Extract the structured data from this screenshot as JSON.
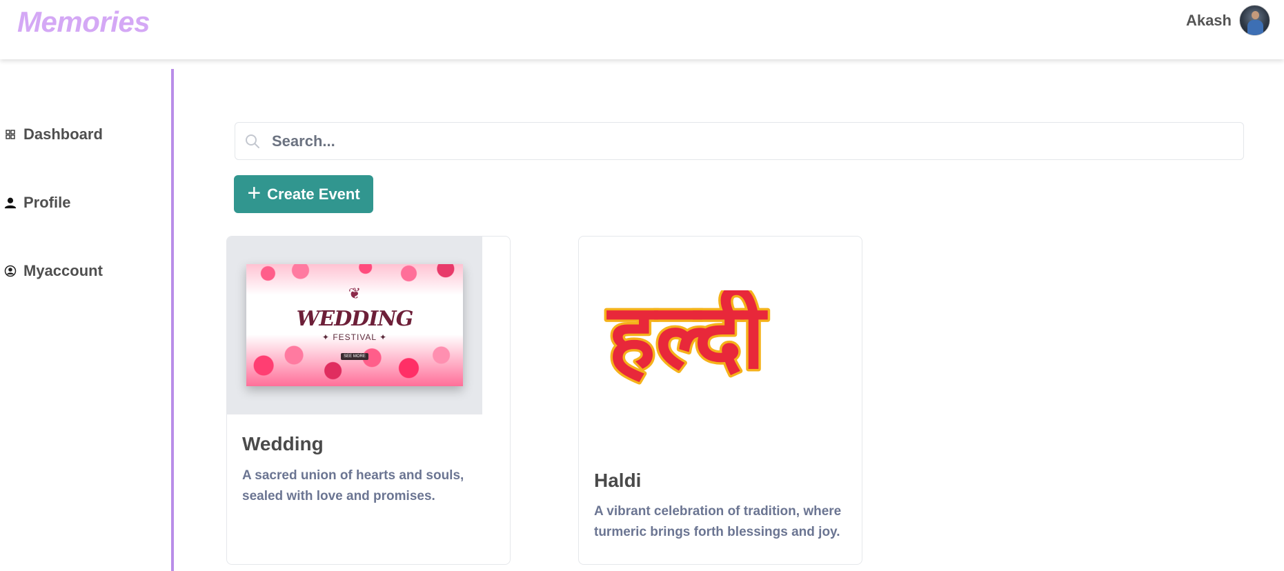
{
  "header": {
    "logo": "Memories",
    "username": "Akash"
  },
  "sidebar": {
    "items": [
      {
        "label": "Dashboard",
        "icon": "grid-icon"
      },
      {
        "label": "Profile",
        "icon": "user-icon"
      },
      {
        "label": "Myaccount",
        "icon": "account-circle-icon"
      }
    ]
  },
  "search": {
    "placeholder": "Search...",
    "value": ""
  },
  "toolbar": {
    "create_label": "Create Event",
    "create_icon": "plus-icon"
  },
  "events": [
    {
      "title": "Wedding",
      "description": "A sacred union of hearts and souls, sealed with love and promises.",
      "image": {
        "title": "WEDDING",
        "subtitle": "FESTIVAL",
        "button": "SEE MORE"
      }
    },
    {
      "title": "Haldi",
      "description": "A vibrant celebration of tradition, where turmeric brings forth blessings and joy.",
      "image": {
        "text": "हल्दी"
      }
    }
  ],
  "colors": {
    "logo": "#d4a8f5",
    "sidebar_border": "#b98de8",
    "primary_button": "#31968f",
    "haldi_red": "#e8283a",
    "haldi_yellow": "#f5b21b"
  }
}
